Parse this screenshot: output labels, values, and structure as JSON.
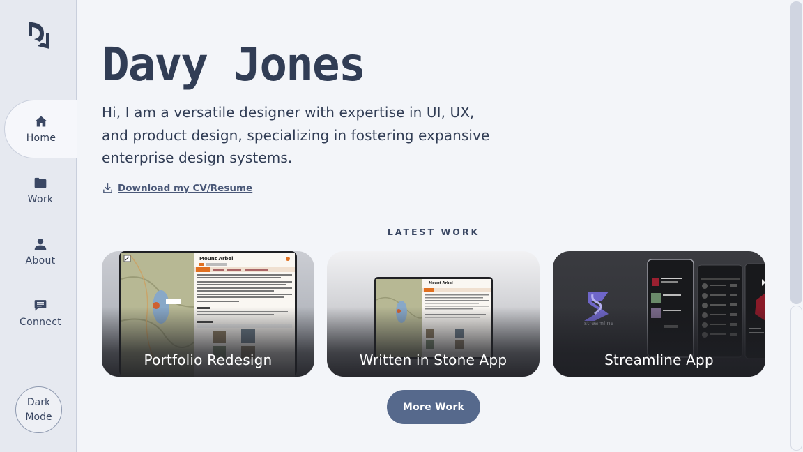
{
  "sidebar": {
    "logo_icon": "dj-monogram-logo",
    "items": [
      {
        "label": "Home",
        "icon": "home-icon",
        "active": true
      },
      {
        "label": "Work",
        "icon": "folder-icon",
        "active": false
      },
      {
        "label": "About",
        "icon": "user-icon",
        "active": false
      },
      {
        "label": "Connect",
        "icon": "chat-icon",
        "active": false
      }
    ],
    "dark_mode": {
      "line1": "Dark",
      "line2": "Mode"
    }
  },
  "hero": {
    "name": "Davy Jones",
    "intro": "Hi, I am a versatile designer with expertise in UI, UX, and product design, specializing in fostering expansive enterprise design systems.",
    "cv_link": "Download my CV/Resume"
  },
  "latest_work": {
    "label": "LATEST WORK",
    "cards": [
      {
        "title": "Portfolio Redesign",
        "mock_heading": "Mount Arbel"
      },
      {
        "title": "Written in Stone App",
        "mock_heading": "Mount Arbel"
      },
      {
        "title": "Streamline App",
        "mock_logo": "streamline"
      }
    ],
    "more_button": "More Work"
  },
  "colors": {
    "background": "#f3f5f9",
    "sidebar": "#e6e9f0",
    "text": "#313d55",
    "button": "#56698c"
  }
}
